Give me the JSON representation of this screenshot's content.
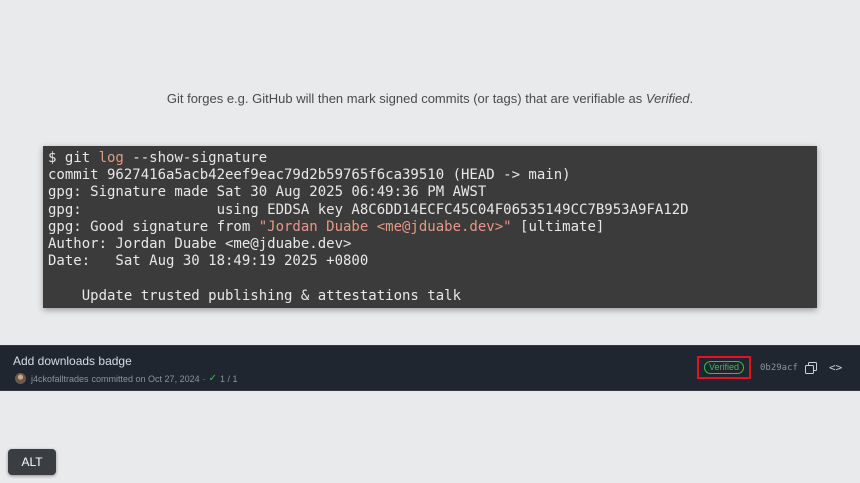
{
  "caption": {
    "before": "Git forges e.g. GitHub will then mark signed commits (or tags) that are verifiable as ",
    "emph": "Verified",
    "after": "."
  },
  "terminal": {
    "l1": {
      "prompt": "$ git ",
      "kw": "log",
      "rest": " --show-signature"
    },
    "l2": "commit 9627416a5acb42eef9eac79d2b59765f6ca39510 (HEAD -> main)",
    "l3": "gpg: Signature made Sat 30 Aug 2025 06:49:36 PM AWST",
    "l4": "gpg:                using EDDSA key A8C6DD14ECFC45C04F06535149CC7B953A9FA12D",
    "l5": {
      "pre": "gpg: Good signature from ",
      "str": "\"Jordan Duabe <me@jduabe.dev>\"",
      "post": " [ultimate]"
    },
    "l6": "Author: Jordan Duabe <me@jduabe.dev>",
    "l7": "Date:   Sat Aug 30 18:49:19 2025 +0800",
    "l8": "",
    "l9": "    Update trusted publishing & attestations talk"
  },
  "commit_bar": {
    "title": "Add downloads badge",
    "author": "j4ckofalltrades",
    "committed": "committed on Oct 27, 2024",
    "sep": "·",
    "checks": "1 / 1",
    "verified": "Verified",
    "sha": "0b29acf",
    "icons": {
      "copy": "copy-icon",
      "browse": "code-icon",
      "check": "check-icon",
      "avatar": "avatar"
    }
  },
  "alt_button": "ALT",
  "colors": {
    "verified": "#3fb950",
    "highlight_box": "#e2141b",
    "terminal_bg": "#3b3b3b",
    "keyword": "#e49a86"
  }
}
